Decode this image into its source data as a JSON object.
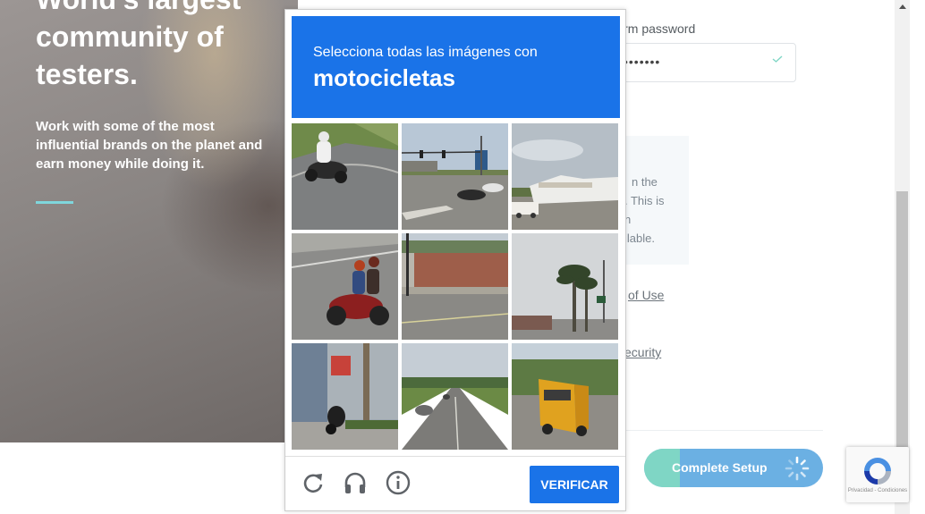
{
  "hero": {
    "title_lines": [
      "World's largest",
      "community of",
      "testers."
    ],
    "subtitle": "Work with some of the most influential brands on the planet and earn money while doing it."
  },
  "form": {
    "confirm_password_label": "irm password",
    "password_value": "•••••••",
    "info_lines": [
      "n the",
      ". This is",
      "n",
      "ilable."
    ],
    "terms_link": "of Use",
    "security_link": "ecurity",
    "complete_button": "Complete Setup",
    "complete_progress": 0.2
  },
  "captcha": {
    "instruction": "Selecciona todas las imágenes con",
    "object": "motocicletas",
    "tiles": [
      {
        "scene": "motorcycle-rider-curve"
      },
      {
        "scene": "intersection-traffic-lights"
      },
      {
        "scene": "rv-park"
      },
      {
        "scene": "motorcycle-couple-road"
      },
      {
        "scene": "brick-building-street"
      },
      {
        "scene": "palm-trees-street"
      },
      {
        "scene": "parked-scooter-storefront"
      },
      {
        "scene": "highway-cars"
      },
      {
        "scene": "school-bus"
      }
    ],
    "verify_button": "VERIFICAR",
    "reload_icon": "reload-icon",
    "audio_icon": "headphones-icon",
    "info_icon": "info-icon",
    "header_color": "#1a73e8"
  },
  "recaptcha_badge": {
    "terms": "Privacidad - Condiciones"
  },
  "colors": {
    "accent_line": "#7fd6dc",
    "button_blue": "#6bb0e3",
    "button_progress": "#7fd6c5"
  }
}
